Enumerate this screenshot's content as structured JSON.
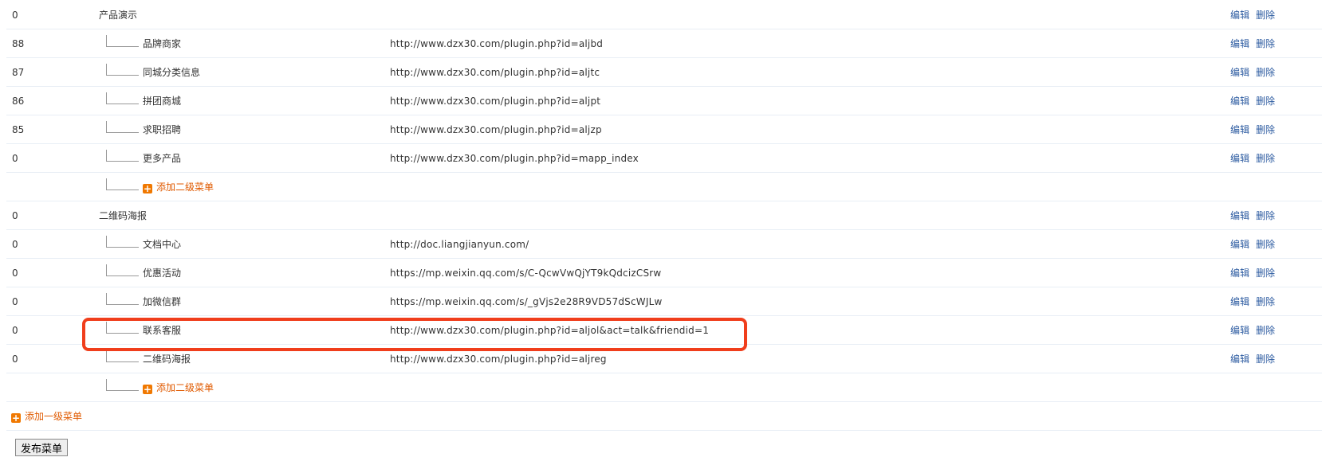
{
  "actions": {
    "edit_label": "编辑",
    "delete_label": "删除"
  },
  "add_second_level_label": "添加二级菜单",
  "add_first_level_label": "添加一级菜单",
  "publish_button_label": "发布菜单",
  "highlight_color": "#f03e1c",
  "link_color": "#2b5aa0",
  "add_link_color": "#e05a00",
  "rows": [
    {
      "type": "menu",
      "level": 1,
      "order": "0",
      "name": "产品演示",
      "url": ""
    },
    {
      "type": "menu",
      "level": 2,
      "order": "88",
      "name": "品牌商家",
      "url": "http://www.dzx30.com/plugin.php?id=aljbd"
    },
    {
      "type": "menu",
      "level": 2,
      "order": "87",
      "name": "同城分类信息",
      "url": "http://www.dzx30.com/plugin.php?id=aljtc"
    },
    {
      "type": "menu",
      "level": 2,
      "order": "86",
      "name": "拼团商城",
      "url": "http://www.dzx30.com/plugin.php?id=aljpt"
    },
    {
      "type": "menu",
      "level": 2,
      "order": "85",
      "name": "求职招聘",
      "url": "http://www.dzx30.com/plugin.php?id=aljzp"
    },
    {
      "type": "menu",
      "level": 2,
      "order": "0",
      "name": "更多产品",
      "url": "http://www.dzx30.com/plugin.php?id=mapp_index"
    },
    {
      "type": "add2"
    },
    {
      "type": "menu",
      "level": 1,
      "order": "0",
      "name": "二维码海报",
      "url": ""
    },
    {
      "type": "menu",
      "level": 2,
      "order": "0",
      "name": "文档中心",
      "url": "http://doc.liangjianyun.com/"
    },
    {
      "type": "menu",
      "level": 2,
      "order": "0",
      "name": "优惠活动",
      "url": "https://mp.weixin.qq.com/s/C-QcwVwQjYT9kQdcizCSrw"
    },
    {
      "type": "menu",
      "level": 2,
      "order": "0",
      "name": "加微信群",
      "url": "https://mp.weixin.qq.com/s/_gVjs2e28R9VD57dScWJLw"
    },
    {
      "type": "menu",
      "level": 2,
      "order": "0",
      "name": "联系客服",
      "url": "http://www.dzx30.com/plugin.php?id=aljol&act=talk&friendid=1"
    },
    {
      "type": "menu",
      "level": 2,
      "order": "0",
      "name": "二维码海报",
      "url": "http://www.dzx30.com/plugin.php?id=aljreg"
    },
    {
      "type": "add2"
    },
    {
      "type": "add1"
    }
  ]
}
